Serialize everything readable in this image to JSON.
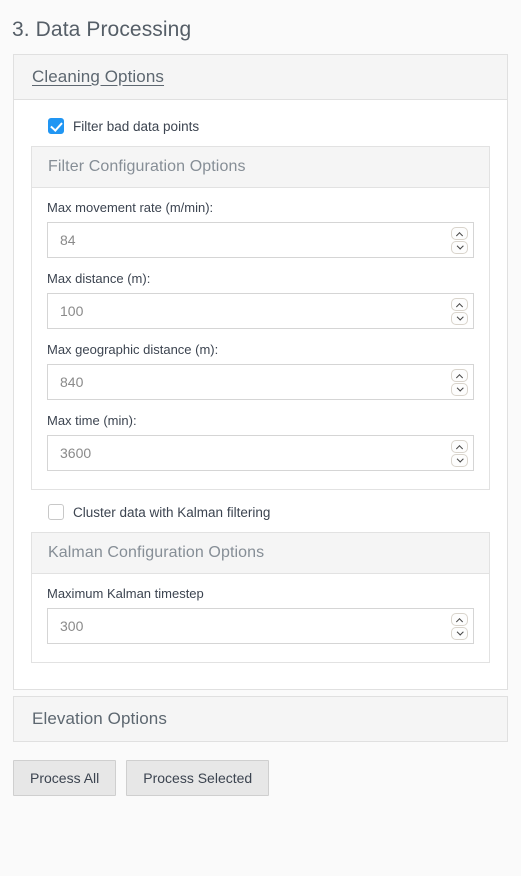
{
  "page": {
    "title": "3. Data Processing"
  },
  "colors": {
    "accent": "#2196f3",
    "panel_header_bg": "#f5f5f5",
    "border": "#e0e0e0",
    "button_bg": "#e7e7e7",
    "text": "#3c4450",
    "muted_text": "#868e96",
    "placeholder_text": "#8a8a8a"
  },
  "cleaning_panel": {
    "title": "Cleaning Options",
    "expanded": true,
    "filter_checkbox": {
      "label": "Filter bad data points",
      "checked": true
    },
    "filter_config": {
      "title": "Filter Configuration Options",
      "fields": [
        {
          "label": "Max movement rate (m/min):",
          "value": "84"
        },
        {
          "label": "Max distance (m):",
          "value": "100"
        },
        {
          "label": "Max geographic distance (m):",
          "value": "840"
        },
        {
          "label": "Max time (min):",
          "value": "3600"
        }
      ]
    },
    "kalman_checkbox": {
      "label": "Cluster data with Kalman filtering",
      "checked": false
    },
    "kalman_config": {
      "title": "Kalman Configuration Options",
      "fields": [
        {
          "label": "Maximum Kalman timestep",
          "value": "300"
        }
      ]
    }
  },
  "elevation_panel": {
    "title": "Elevation Options",
    "expanded": false
  },
  "footer": {
    "process_all_label": "Process All",
    "process_selected_label": "Process Selected"
  }
}
